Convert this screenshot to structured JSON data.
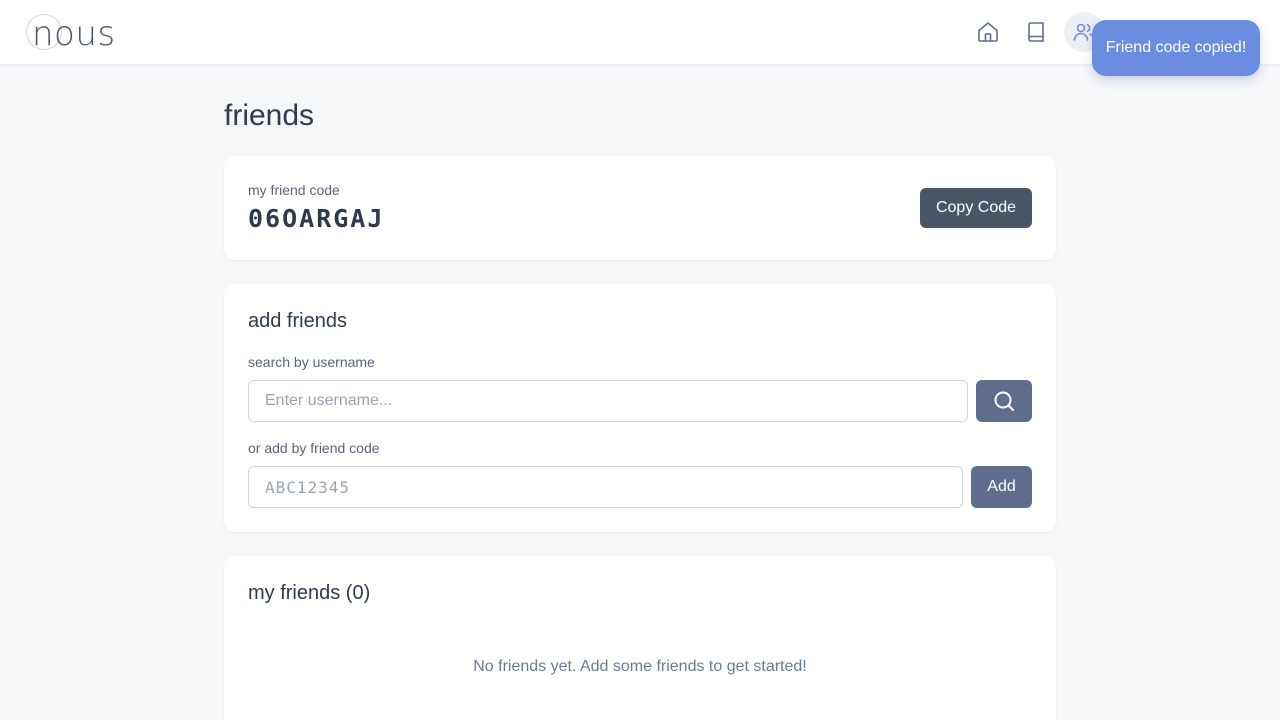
{
  "header": {
    "logo_text": "nous",
    "nav": [
      {
        "name": "home-icon"
      },
      {
        "name": "book-icon"
      },
      {
        "name": "friends-icon",
        "active": true
      }
    ]
  },
  "toast": {
    "message": "Friend code copied!"
  },
  "page": {
    "title": "friends"
  },
  "friend_code_card": {
    "label": "my friend code",
    "code": "06OARGAJ",
    "copy_label": "Copy Code"
  },
  "add_friends": {
    "title": "add friends",
    "search_label": "search by username",
    "search_placeholder": "Enter username...",
    "search_value": "",
    "code_label": "or add by friend code",
    "code_placeholder": "ABC12345",
    "code_value": "",
    "add_label": "Add"
  },
  "friends_list": {
    "title": "my friends (0)",
    "empty_message": "No friends yet. Add some friends to get started!"
  },
  "colors": {
    "accent": "#6b8de0",
    "button_dark": "#4a5568",
    "button_slate": "#5e6e8c",
    "background": "#f6f7f9"
  }
}
